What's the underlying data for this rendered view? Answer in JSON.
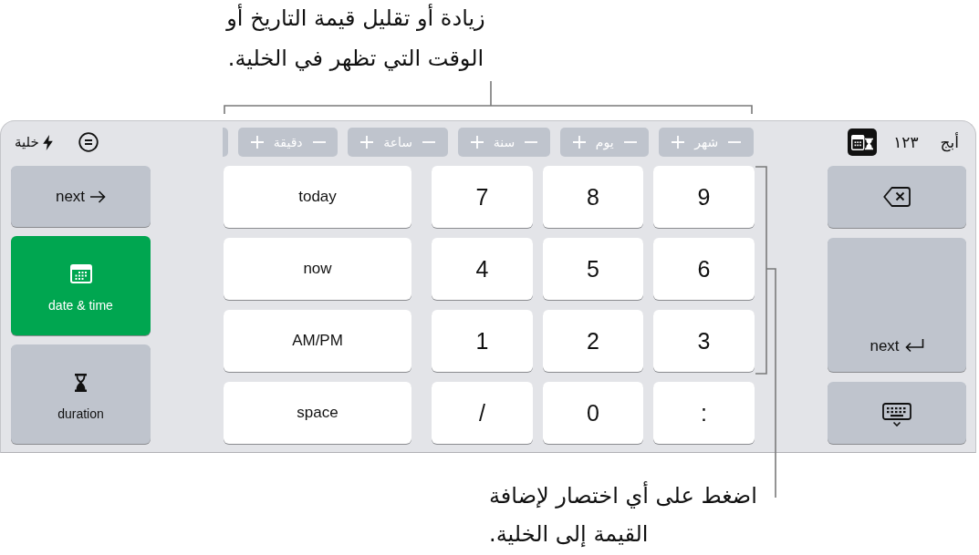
{
  "top_callout": {
    "lines": [
      "زيادة أو تقليل قيمة التاريخ أو",
      "الوقت التي تظهر في الخلية."
    ]
  },
  "toolbar": {
    "cell_button": {
      "label": "خلية"
    }
  },
  "steppers": [
    {
      "label": "شهر"
    },
    {
      "label": "يوم"
    },
    {
      "label": "سنة"
    },
    {
      "label": "ساعة"
    },
    {
      "label": "دقيقة"
    }
  ],
  "mode_tabs": [
    {
      "kind": "text",
      "label": "أبج",
      "selected": false
    },
    {
      "kind": "text",
      "label": "١٢٣",
      "selected": false
    },
    {
      "kind": "icon",
      "selected": true
    }
  ],
  "left_keys": [
    {
      "kind": "next",
      "label": "next"
    },
    {
      "kind": "datetime",
      "label": "date & time",
      "selected": true
    },
    {
      "kind": "duration",
      "label": "duration",
      "selected": false
    }
  ],
  "shortcut_keys": [
    {
      "label": "today"
    },
    {
      "label": "now"
    },
    {
      "label": "AM/PM"
    },
    {
      "label": "space"
    }
  ],
  "number_keys": [
    [
      "9",
      "8",
      "7"
    ],
    [
      "6",
      "5",
      "4"
    ],
    [
      "3",
      "2",
      "1"
    ],
    [
      ":",
      "0",
      "/"
    ]
  ],
  "right_keys": [
    {
      "kind": "delete"
    },
    {
      "kind": "return",
      "label": "next"
    },
    {
      "kind": "hide"
    }
  ],
  "bottom_callout": {
    "lines": [
      "اضغط على أي اختصار لإضافة",
      "القيمة إلى الخلية."
    ]
  }
}
